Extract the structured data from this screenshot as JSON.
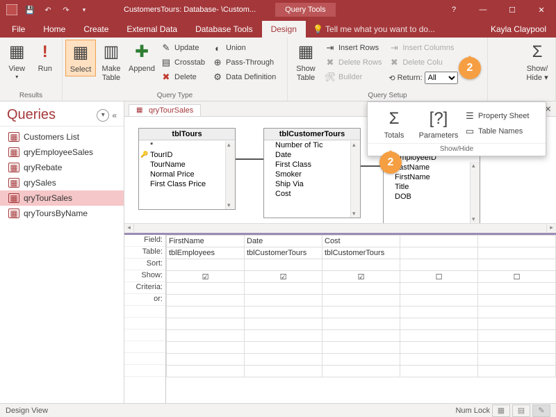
{
  "titlebar": {
    "doc_title": "CustomersTours: Database- \\Custom...",
    "context_tab": "Query Tools",
    "help_icon": "?"
  },
  "tabs": {
    "file": "File",
    "home": "Home",
    "create": "Create",
    "external": "External Data",
    "dbtools": "Database Tools",
    "design": "Design",
    "tellme": "Tell me what you want to do...",
    "user": "Kayla Claypool"
  },
  "ribbon": {
    "results": {
      "view": "View",
      "run": "Run",
      "label": "Results"
    },
    "qtype": {
      "select": "Select",
      "maketable": "Make\nTable",
      "append": "Append",
      "update": "Update",
      "crosstab": "Crosstab",
      "delete": "Delete",
      "union": "Union",
      "passthrough": "Pass-Through",
      "datadef": "Data Definition",
      "label": "Query Type"
    },
    "qsetup": {
      "showtable": "Show\nTable",
      "insert_rows": "Insert Rows",
      "delete_rows": "Delete Rows",
      "builder": "Builder",
      "insert_cols": "Insert Columns",
      "delete_cols": "Delete Colu",
      "return": "Return:",
      "return_val": "All",
      "label": "Query Setup"
    },
    "showhide": {
      "button": "Show/\nHide ▾"
    }
  },
  "flyout": {
    "totals": "Totals",
    "parameters": "Parameters",
    "propsheet": "Property Sheet",
    "tablenames": "Table Names",
    "label": "Show/Hide"
  },
  "nav": {
    "title": "Queries",
    "collapse": "«",
    "items": [
      "Customers List",
      "qryEmployeeSales",
      "qryRebate",
      "qrySales",
      "qryTourSales",
      "qryToursByName"
    ],
    "selected_index": 4
  },
  "doc": {
    "tab": "qryTourSales"
  },
  "tables": {
    "t1": {
      "title": "tblTours",
      "fields": [
        "*",
        "TourID",
        "TourName",
        "Normal Price",
        "First Class Price"
      ],
      "key_index": 1
    },
    "t2": {
      "title": "tblCustomerTours",
      "fields": [
        "Number of Tic",
        "Date",
        "First Class",
        "Smoker",
        "Ship Via",
        "Cost"
      ]
    },
    "t3": {
      "title": "",
      "fields": [
        "EmployeeID",
        "LastName",
        "FirstName",
        "Title",
        "DOB"
      ],
      "key_index": 0
    }
  },
  "qbe": {
    "labels": [
      "Field:",
      "Table:",
      "Sort:",
      "Show:",
      "Criteria:",
      "or:"
    ],
    "cols": [
      {
        "field": "FirstName",
        "table": "tblEmployees",
        "show": true
      },
      {
        "field": "Date",
        "table": "tblCustomerTours",
        "show": true
      },
      {
        "field": "Cost",
        "table": "tblCustomerTours",
        "show": true
      },
      {
        "field": "",
        "table": "",
        "show": false
      },
      {
        "field": "",
        "table": "",
        "show": false
      }
    ]
  },
  "status": {
    "mode": "Design View",
    "lock": "Num Lock"
  },
  "badges": {
    "b2": "2"
  }
}
